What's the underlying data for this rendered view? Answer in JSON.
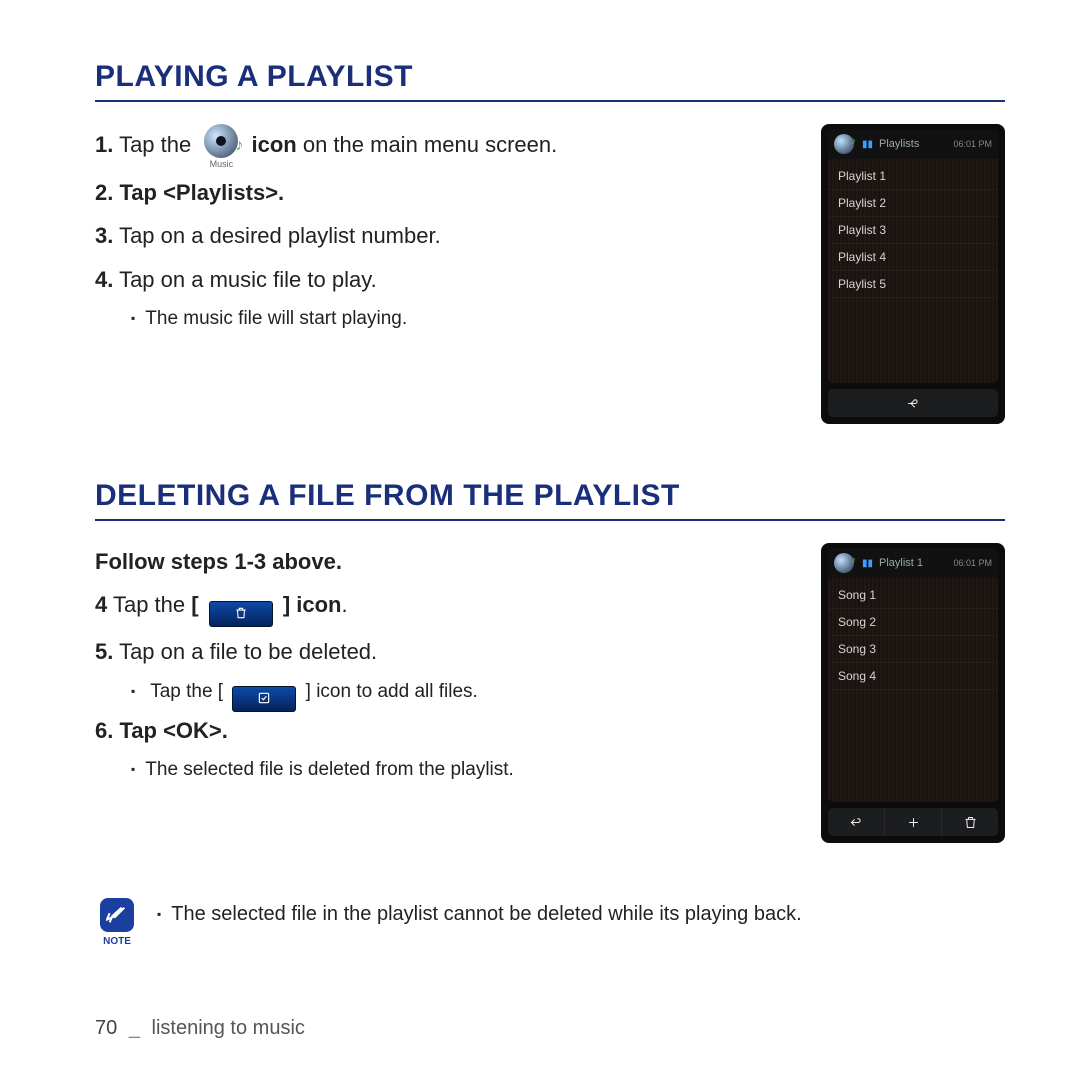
{
  "headings": {
    "playing": "PLAYING A PLAYLIST",
    "deleting": "DELETING A FILE FROM THE PLAYLIST"
  },
  "playing": {
    "step1_a": "1.",
    "step1_b": " Tap the",
    "step1_c": " icon",
    "step1_d": " on the main menu screen.",
    "music_label": "Music",
    "step2_a": "2.",
    "step2_b": " Tap <Playlists>.",
    "step3_a": "3.",
    "step3_b": " Tap on a desired playlist number.",
    "step4_a": "4.",
    "step4_b": " Tap on a music file to play.",
    "bullet": "The music file will start playing."
  },
  "deleting": {
    "follow": "Follow steps 1-3 above.",
    "step4_a": "4",
    "step4_b": " Tap the ",
    "step4_c": "[",
    "step4_d": "]",
    "step4_e": " icon",
    "step4_f": ".",
    "step5_a": "5.",
    "step5_b": " Tap on a file to be deleted.",
    "bullet5_a": "Tap the [",
    "bullet5_b": "] icon to add all files.",
    "step6_a": "6.",
    "step6_b": " Tap <OK>.",
    "bullet6": "The selected file is deleted from the playlist."
  },
  "note": {
    "label": "NOTE",
    "text": "The selected file in the playlist cannot be deleted while its playing back."
  },
  "footer": {
    "page": "70",
    "sep": "_",
    "chapter": "listening to music"
  },
  "device1": {
    "title": "Playlists",
    "time": "06:01 PM",
    "items": [
      "Playlist 1",
      "Playlist 2",
      "Playlist 3",
      "Playlist 4",
      "Playlist 5"
    ]
  },
  "device2": {
    "title": "Playlist 1",
    "time": "06:01 PM",
    "items": [
      "Song 1",
      "Song 2",
      "Song 3",
      "Song 4"
    ]
  }
}
